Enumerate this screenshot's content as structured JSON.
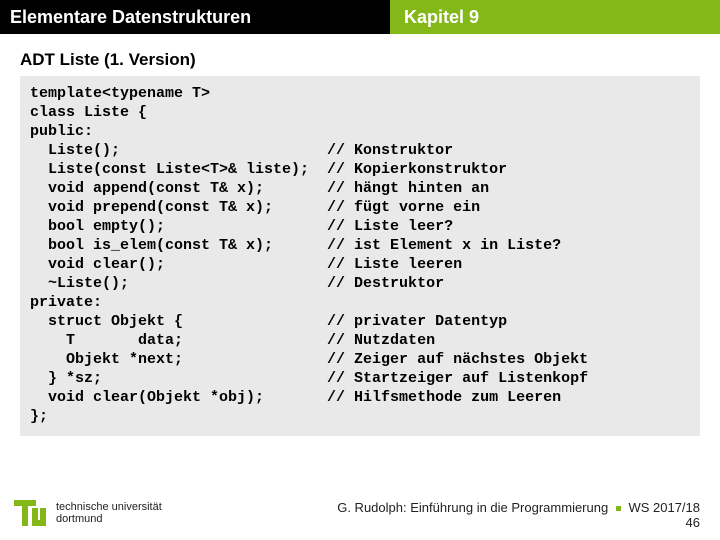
{
  "header": {
    "left": "Elementare Datenstrukturen",
    "right": "Kapitel 9"
  },
  "title": "ADT Liste (1. Version)",
  "code": "template<typename T>\nclass Liste {\npublic:\n  Liste();                       // Konstruktor\n  Liste(const Liste<T>& liste);  // Kopierkonstruktor\n  void append(const T& x);       // hängt hinten an\n  void prepend(const T& x);      // fügt vorne ein\n  bool empty();                  // Liste leer?\n  bool is_elem(const T& x);      // ist Element x in Liste?\n  void clear();                  // Liste leeren\n  ~Liste();                      // Destruktor\nprivate:\n  struct Objekt {                // privater Datentyp\n    T       data;                // Nutzdaten\n    Objekt *next;                // Zeiger auf nächstes Objekt\n  } *sz;                         // Startzeiger auf Listenkopf\n  void clear(Objekt *obj);       // Hilfsmethode zum Leeren\n};",
  "logo": {
    "line1": "technische universität",
    "line2": "dortmund"
  },
  "footer": {
    "author": "G. Rudolph: Einführung in die Programmierung",
    "term": "WS 2017/18",
    "page": "46"
  }
}
